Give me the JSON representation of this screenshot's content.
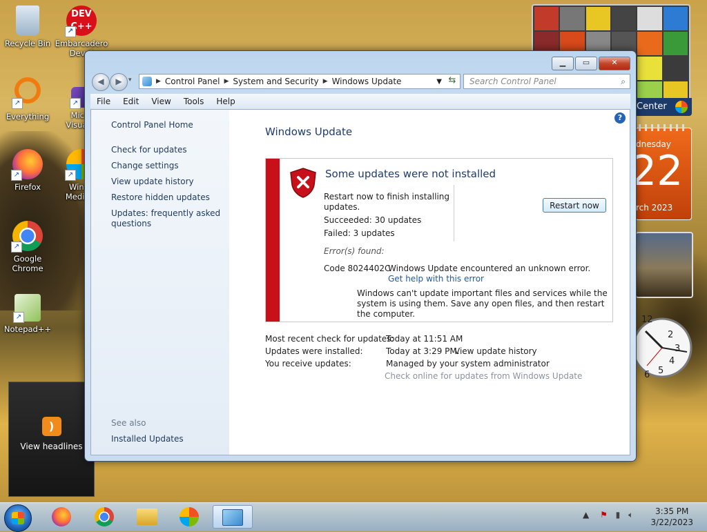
{
  "desktop": {
    "icons": [
      {
        "label": "Recycle Bin",
        "icon": "recycle-bin-icon"
      },
      {
        "label": "Embarcadero Dev-C",
        "icon": "devcpp-icon",
        "logo_text": "DEV C++"
      },
      {
        "label": "Everything",
        "icon": "everything-icon"
      },
      {
        "label": "Micro Visual S",
        "icon": "visual-studio-icon"
      },
      {
        "label": "Firefox",
        "icon": "firefox-icon"
      },
      {
        "label": "Windo Media C",
        "icon": "media-center-icon"
      },
      {
        "label": "Google Chrome",
        "icon": "chrome-icon"
      },
      {
        "label": "Notepad++",
        "icon": "notepadpp-icon"
      }
    ],
    "headlines_gadget": {
      "label": "View headlines"
    }
  },
  "gadgets": {
    "media_center_label": "Center",
    "calendar": {
      "weekday": "dnesday",
      "day": "22",
      "month_year": "rch 2023"
    },
    "clock_numbers": [
      "12",
      "2",
      "3",
      "4",
      "5",
      "6"
    ]
  },
  "window": {
    "breadcrumb": [
      "Control Panel",
      "System and Security",
      "Windows Update"
    ],
    "search_placeholder": "Search Control Panel",
    "menu": [
      "File",
      "Edit",
      "View",
      "Tools",
      "Help"
    ],
    "left_pane": {
      "home": "Control Panel Home",
      "links": [
        "Check for updates",
        "Change settings",
        "View update history",
        "Restore hidden updates",
        "Updates: frequently asked questions"
      ],
      "see_also": "See also",
      "see_also_links": [
        "Installed Updates"
      ]
    },
    "title": "Windows Update",
    "alert": {
      "title": "Some updates were not installed",
      "line1": "Restart now to finish installing",
      "line2": "updates.",
      "succeeded": "Succeeded: 30 updates",
      "failed": "Failed: 3 updates",
      "restart_button": "Restart now",
      "errors_found": "Error(s) found:",
      "code": "Code 8024402C",
      "error_message": "Windows Update encountered an unknown error.",
      "help_link": "Get help with this error",
      "note1": "Windows can't update important files and services while the",
      "note2": "system is using them. Save any open files, and then restart",
      "note3": "the computer."
    },
    "info": {
      "recent_check_label": "Most recent check for updates:",
      "recent_check_value": "Today at 11:51 AM",
      "installed_label": "Updates were installed:",
      "installed_value": "Today at 3:29 PM.",
      "history_link": "View update history",
      "receive_label": "You receive updates:",
      "receive_value": "Managed by your system administrator",
      "online_link": "Check online for updates from Windows Update"
    }
  },
  "taskbar": {
    "apps": [
      "firefox-icon",
      "chrome-icon",
      "explorer-icon",
      "media-center-icon",
      "control-panel-icon"
    ],
    "time": "3:35 PM",
    "date": "3/22/2023"
  },
  "colors": {
    "alert_bar": "#c8101a",
    "link": "#1e5aa8",
    "title": "#1e3b6e"
  }
}
